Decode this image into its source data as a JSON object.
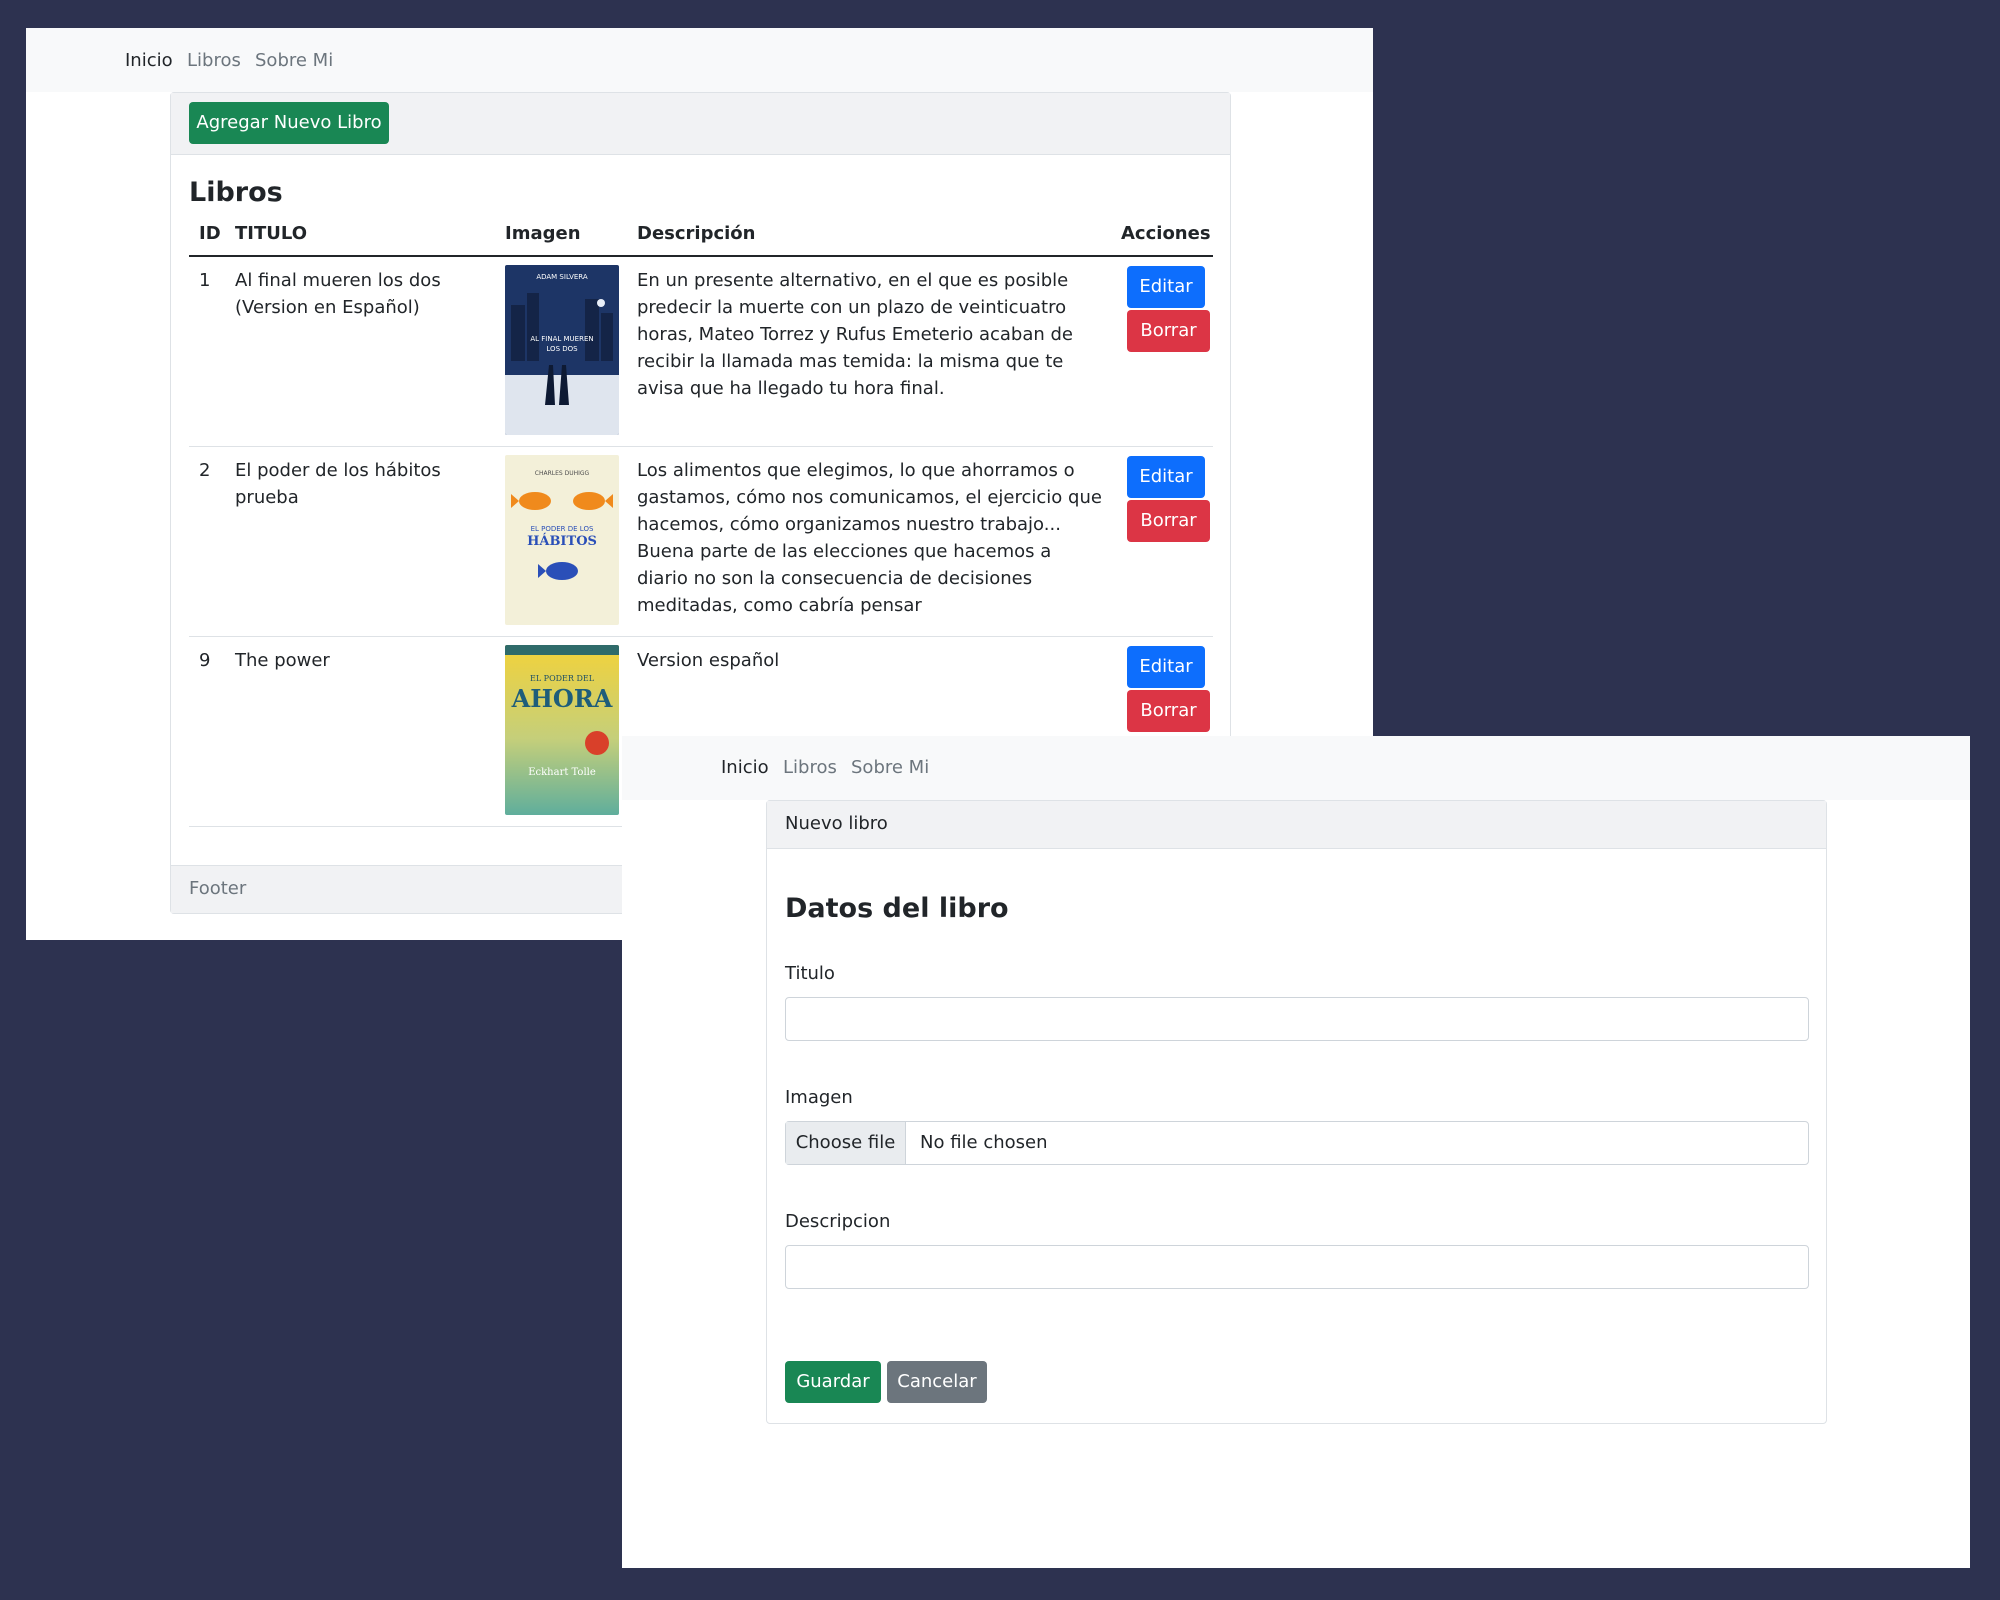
{
  "list_window": {
    "nav": {
      "inicio": "Inicio",
      "libros": "Libros",
      "sobre_mi": "Sobre Mi"
    },
    "add_button": "Agregar Nuevo Libro",
    "title": "Libros",
    "table": {
      "headers": {
        "id": "ID",
        "title": "TITULO",
        "image": "Imagen",
        "description": "Descripción",
        "actions": "Acciones"
      },
      "rows": [
        {
          "id": "1",
          "title": "Al final mueren los dos (Version en Español)",
          "description": "En un presente alternativo, en el que es posible predecir la muerte con un plazo de veinticuatro horas, Mateo Torrez y Rufus Emeterio acaban de recibir la llamada mas temida: la misma que te avisa que ha llegado tu hora final.",
          "edit": "Editar",
          "delete": "Borrar",
          "cover": {
            "author": "ADAM SILVERA",
            "title_line1": "AL FINAL MUEREN",
            "title_line2": "LOS DOS"
          }
        },
        {
          "id": "2",
          "title": "El poder de los hábitos prueba",
          "description": "Los alimentos que elegimos, lo que ahorramos o gastamos, cómo nos comunicamos, el ejercicio que hacemos, cómo organizamos nuestro trabajo... Buena parte de las elecciones que hacemos a diario no son la consecuencia de decisiones meditadas, como cabría pensar",
          "edit": "Editar",
          "delete": "Borrar",
          "cover": {
            "author": "CHARLES DUHIGG",
            "title_line1": "EL PODER DE LOS",
            "title_line2": "HÁBITOS"
          }
        },
        {
          "id": "9",
          "title": "The power",
          "description": "Version español",
          "edit": "Editar",
          "delete": "Borrar",
          "cover": {
            "title_line1": "EL PODER DEL",
            "title_line2": "AHORA",
            "author": "Eckhart Tolle"
          }
        }
      ]
    },
    "footer": "Footer"
  },
  "form_window": {
    "nav": {
      "inicio": "Inicio",
      "libros": "Libros",
      "sobre_mi": "Sobre Mi"
    },
    "card_header": "Nuevo libro",
    "heading": "Datos del libro",
    "fields": {
      "titulo": {
        "label": "Titulo",
        "value": ""
      },
      "imagen": {
        "label": "Imagen",
        "button": "Choose file",
        "status": "No file chosen"
      },
      "descripcion": {
        "label": "Descripcion",
        "value": ""
      }
    },
    "buttons": {
      "save": "Guardar",
      "cancel": "Cancelar"
    }
  },
  "colors": {
    "background": "#2d3250",
    "success": "#198754",
    "primary": "#0d6efd",
    "danger": "#dc3545",
    "secondary": "#6c757d"
  }
}
